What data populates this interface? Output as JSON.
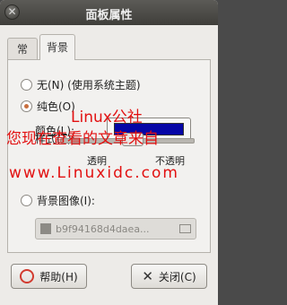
{
  "window": {
    "title": "面板属性",
    "close_icon": "✕"
  },
  "tabs": [
    {
      "label": "常规"
    },
    {
      "label": "背景"
    }
  ],
  "background": {
    "option_none": "无(N) (使用系统主题)",
    "option_solid": "纯色(O)",
    "color_label": "颜色(L):",
    "style_label": "样式(T):",
    "slider_min_label": "透明",
    "slider_max_label": "不透明",
    "option_image": "背景图像(I):",
    "image_file": "b9f94168d4daea...",
    "selected_color": "#0606A6"
  },
  "buttons": {
    "help": "帮助(H)",
    "close": "关闭(C)"
  },
  "watermark": {
    "line1": "Linux公社",
    "line2": "您现在查看的文章来自",
    "line3": "www.Linuxidc.com"
  }
}
